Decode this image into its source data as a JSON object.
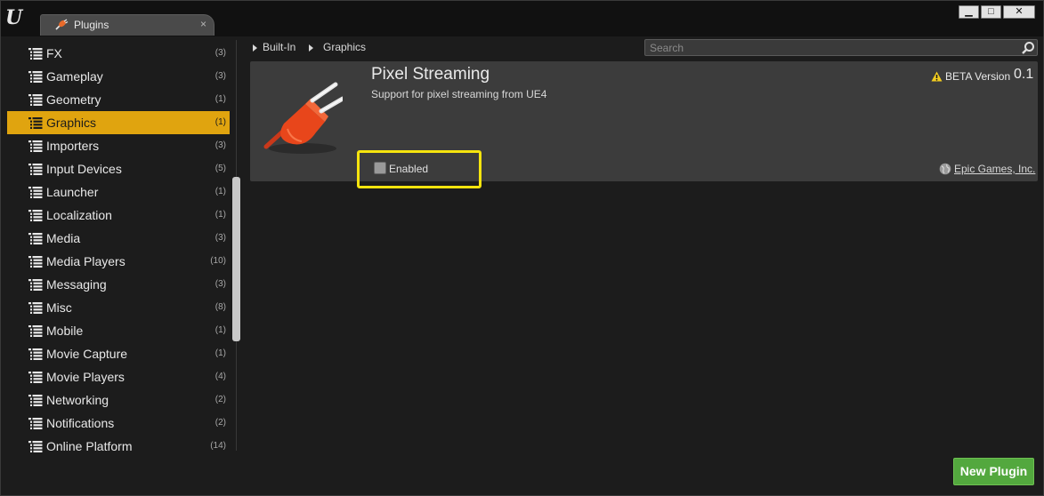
{
  "window": {
    "tab_title": "Plugins",
    "tab_close": "×",
    "controls": {
      "minimize": "▁",
      "maximize": "□",
      "close": "✕"
    }
  },
  "sidebar": {
    "categories": [
      {
        "label": "FX",
        "count": "(3)"
      },
      {
        "label": "Gameplay",
        "count": "(3)"
      },
      {
        "label": "Geometry",
        "count": "(1)"
      },
      {
        "label": "Graphics",
        "count": "(1)",
        "selected": true
      },
      {
        "label": "Importers",
        "count": "(3)"
      },
      {
        "label": "Input Devices",
        "count": "(5)"
      },
      {
        "label": "Launcher",
        "count": "(1)"
      },
      {
        "label": "Localization",
        "count": "(1)"
      },
      {
        "label": "Media",
        "count": "(3)"
      },
      {
        "label": "Media Players",
        "count": "(10)"
      },
      {
        "label": "Messaging",
        "count": "(3)"
      },
      {
        "label": "Misc",
        "count": "(8)"
      },
      {
        "label": "Mobile",
        "count": "(1)"
      },
      {
        "label": "Movie Capture",
        "count": "(1)"
      },
      {
        "label": "Movie Players",
        "count": "(4)"
      },
      {
        "label": "Networking",
        "count": "(2)"
      },
      {
        "label": "Notifications",
        "count": "(2)"
      },
      {
        "label": "Online Platform",
        "count": "(14)"
      }
    ]
  },
  "breadcrumb": {
    "items": [
      "Built-In",
      "Graphics"
    ]
  },
  "search": {
    "placeholder": "Search",
    "icon": "search-icon"
  },
  "plugin": {
    "name": "Pixel Streaming",
    "description": "Support for pixel streaming from UE4",
    "beta_label": "BETA Version",
    "version": "0.1",
    "enabled_label": "Enabled",
    "enabled": false,
    "author": "Epic Games, Inc.",
    "icon": "plug-icon"
  },
  "footer": {
    "new_plugin_label": "New Plugin"
  },
  "colors": {
    "selected": "#e0a40f",
    "highlight": "#f5e40e",
    "new_plugin": "#53a83e",
    "plug": "#e8461b"
  }
}
